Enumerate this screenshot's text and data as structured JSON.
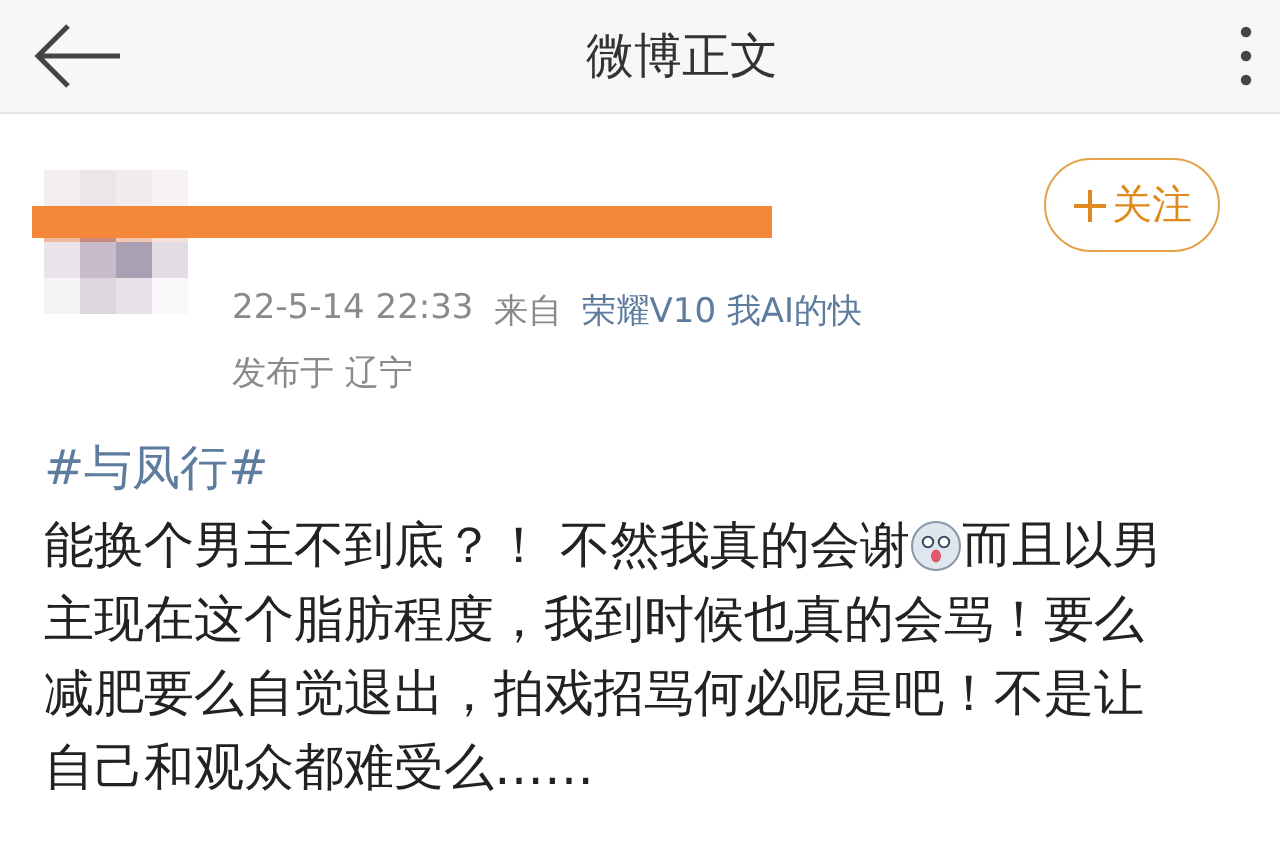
{
  "header": {
    "title": "微博正文"
  },
  "author": {
    "name_redacted": true,
    "follow_label": "关注",
    "time": "22-5-14 22:33",
    "source_prefix": "来自",
    "source": "荣耀V10 我AI的快",
    "location": "发布于 辽宁"
  },
  "post": {
    "hashtag": "#与凤行#",
    "lines": [
      [
        {
          "kind": "text",
          "text": "能换个男主不到底？！ 不然我真的会谢"
        },
        {
          "kind": "emoji"
        },
        {
          "kind": "text",
          "text": "而且以男"
        }
      ],
      [
        {
          "kind": "text",
          "text": "主现在这个脂肪程度，我到时候也真的会骂！要么"
        }
      ],
      [
        {
          "kind": "text",
          "text": "减肥要么自觉退出，拍戏招骂何必呢是吧！不是让"
        }
      ],
      [
        {
          "kind": "text",
          "text": "自己和观众都难受么……"
        }
      ]
    ]
  }
}
